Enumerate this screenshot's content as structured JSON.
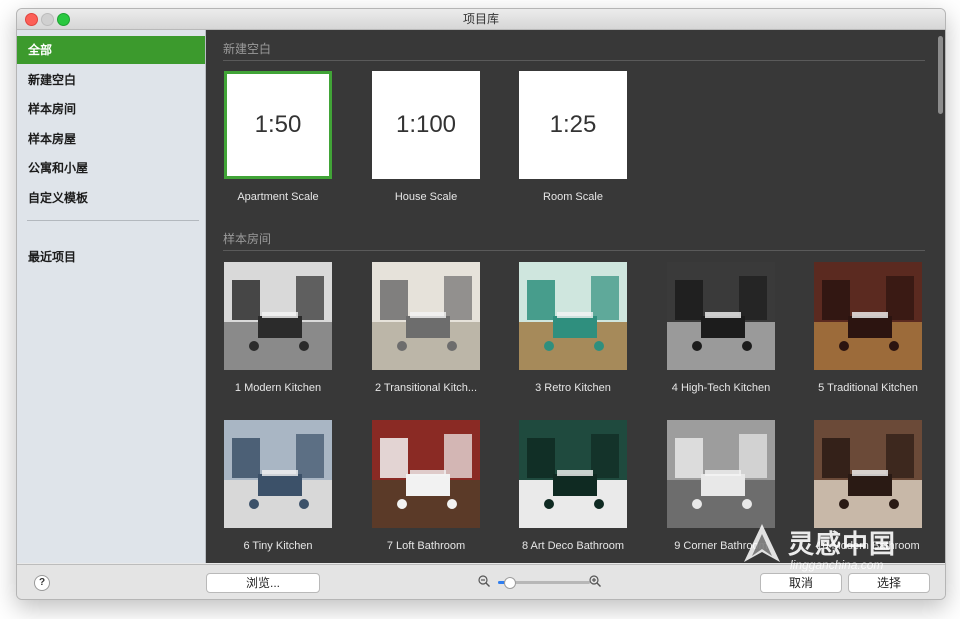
{
  "window": {
    "title": "项目库"
  },
  "sidebar": {
    "items": [
      {
        "label": "全部",
        "active": true
      },
      {
        "label": "新建空白"
      },
      {
        "label": "样本房间"
      },
      {
        "label": "样本房屋"
      },
      {
        "label": "公寓和小屋"
      },
      {
        "label": "自定义模板"
      }
    ],
    "recent": {
      "label": "最近项目"
    }
  },
  "sections": {
    "new_blank": {
      "title": "新建空白",
      "tiles": [
        {
          "scale": "1:50",
          "caption": "Apartment Scale",
          "selected": true
        },
        {
          "scale": "1:100",
          "caption": "House Scale"
        },
        {
          "scale": "1:25",
          "caption": "Room Scale"
        }
      ]
    },
    "sample_rooms": {
      "title": "样本房间",
      "tiles": [
        {
          "caption": "1 Modern Kitchen",
          "icon": "kitchen-image"
        },
        {
          "caption": "2 Transitional Kitch...",
          "icon": "kitchen-image"
        },
        {
          "caption": "3 Retro Kitchen",
          "icon": "kitchen-image"
        },
        {
          "caption": "4 High-Tech Kitchen",
          "icon": "kitchen-image"
        },
        {
          "caption": "5 Traditional Kitchen",
          "icon": "kitchen-image"
        },
        {
          "caption": "6 Tiny Kitchen",
          "icon": "kitchen-image"
        },
        {
          "caption": "7 Loft Bathroom",
          "icon": "bathroom-image"
        },
        {
          "caption": "8 Art Deco Bathroom",
          "icon": "bathroom-image"
        },
        {
          "caption": "9 Corner Bathroom",
          "icon": "bathroom-image"
        },
        {
          "caption": "10 Modern Bathroom",
          "icon": "bathroom-image"
        }
      ]
    }
  },
  "bottombar": {
    "help": "?",
    "browse_label": "浏览...",
    "cancel_label": "取消",
    "select_label": "选择",
    "zoom_level": 0.12
  },
  "watermark": {
    "cn": "灵感中国",
    "en": "lingganchina.com"
  },
  "colors": {
    "accent_green": "#3c9a2d",
    "content_bg": "#383838",
    "sidebar_bg": "#dfe4ea"
  }
}
